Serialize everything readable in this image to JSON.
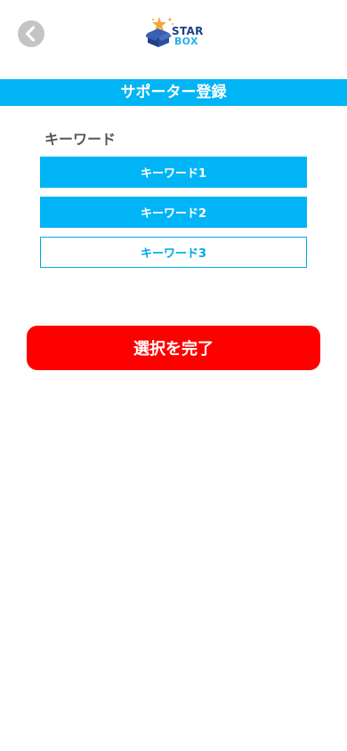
{
  "header": {
    "logo_line1": "STAR",
    "logo_line2": "BOX",
    "back_icon": "chevron-left-icon"
  },
  "title_bar": {
    "title": "サポーター登録"
  },
  "keyword_section": {
    "label": "キーワード",
    "options": [
      {
        "label": "キーワード1",
        "selected": true
      },
      {
        "label": "キーワード2",
        "selected": true
      },
      {
        "label": "キーワード3",
        "selected": false
      }
    ]
  },
  "footer_action": {
    "complete_label": "選択を完了"
  },
  "colors": {
    "accent": "#00b4f5",
    "action": "#ff0000",
    "back_button": "#c4c4c4",
    "logo_navy": "#1e3f8a",
    "logo_light_blue": "#2aaee6",
    "logo_star": "#f2a531"
  }
}
